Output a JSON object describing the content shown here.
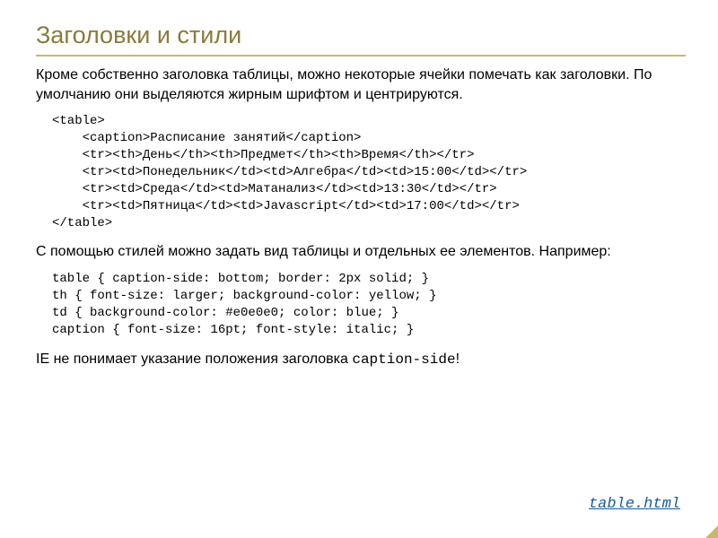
{
  "title": "Заголовки и стили",
  "para1": "Кроме собственно заголовка таблицы, можно некоторые ячейки помечать как заголовки. По умолчанию они выделяются жирным шрифтом и центрируются.",
  "code1": "<table>\n    <caption>Расписание занятий</caption>\n    <tr><th>День</th><th>Предмет</th><th>Время</th></tr>\n    <tr><td>Понедельник</td><td>Алгебра</td><td>15:00</td></tr>\n    <tr><td>Среда</td><td>Матанализ</td><td>13:30</td></tr>\n    <tr><td>Пятница</td><td>Javascript</td><td>17:00</td></tr>\n</table>",
  "para2": "С помощью стилей можно задать вид таблицы и отдельных ее элементов. Например:",
  "code2": "table { caption-side: bottom; border: 2px solid; }\nth { font-size: larger; background-color: yellow; }\ntd { background-color: #e0e0e0; color: blue; }\ncaption { font-size: 16pt; font-style: italic; }",
  "note_prefix": "IE не понимает указание положения заголовка ",
  "note_mono": "caption-side",
  "note_suffix": "!",
  "link": "table.html"
}
